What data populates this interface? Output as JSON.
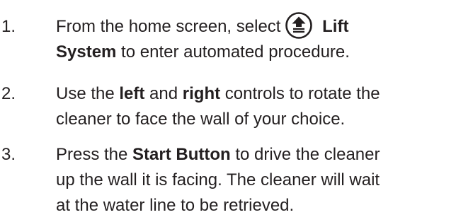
{
  "steps": [
    {
      "number": "1.",
      "lines": [
        {
          "before_icon": "From the home screen, select",
          "icon": "lift-system-icon",
          "bold_after": "Lift"
        },
        {
          "bold": "System",
          "text": " to enter automated procedure."
        }
      ]
    },
    {
      "number": "2.",
      "lines": [
        {
          "t1": "Use the ",
          "b1": "left",
          "t2": " and ",
          "b2": "right",
          "t3": " controls to rotate the"
        },
        {
          "text": "cleaner to face the wall of your choice."
        }
      ]
    },
    {
      "number": "3.",
      "lines": [
        {
          "t1": "Press the ",
          "b1": "Start Button",
          "t2": " to drive the cleaner"
        },
        {
          "text": "up the wall it is facing. The cleaner will wait"
        },
        {
          "text": "at the water line to be retrieved."
        }
      ]
    }
  ]
}
